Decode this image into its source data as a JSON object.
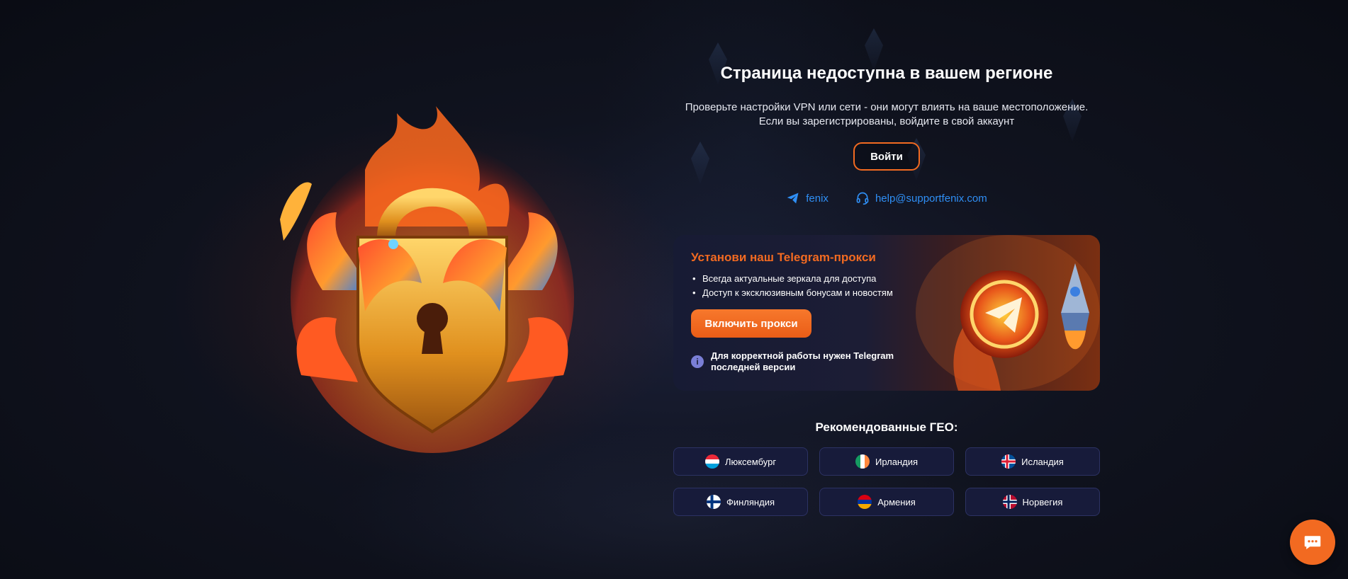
{
  "header": {
    "title": "Страница недоступна в вашем регионе",
    "subtitle_line1": "Проверьте настройки VPN или сети - они могут влиять на ваше местоположение.",
    "subtitle_line2": "Если вы зарегистрированы, войдите в свой аккаунт",
    "login_label": "Войти"
  },
  "contacts": {
    "telegram": {
      "label": "fenix",
      "icon": "telegram-icon"
    },
    "support": {
      "label": "help@supportfenix.com",
      "icon": "headset-icon"
    }
  },
  "proxy": {
    "title": "Установи наш Telegram-прокси",
    "items": [
      "Всегда актуальные зеркала для доступа",
      "Доступ к эксклюзивным бонусам и новостям"
    ],
    "button_label": "Включить прокси",
    "note_line1": "Для корректной работы нужен Telegram",
    "note_line2": "последней версии"
  },
  "geo": {
    "title": "Рекомендованные ГЕО:",
    "countries": [
      {
        "label": "Люксембург",
        "flag": "flag-luxembourg"
      },
      {
        "label": "Ирландия",
        "flag": "flag-ireland"
      },
      {
        "label": "Исландия",
        "flag": "flag-iceland"
      },
      {
        "label": "Финляндия",
        "flag": "flag-finland"
      },
      {
        "label": "Армения",
        "flag": "flag-armenia"
      },
      {
        "label": "Норвегия",
        "flag": "flag-norway"
      }
    ]
  },
  "colors": {
    "accent": "#f26a21",
    "link": "#2f8ff5",
    "background": "#10131f",
    "geo_button": "#171b3a"
  },
  "chat": {
    "icon": "chat-icon"
  }
}
